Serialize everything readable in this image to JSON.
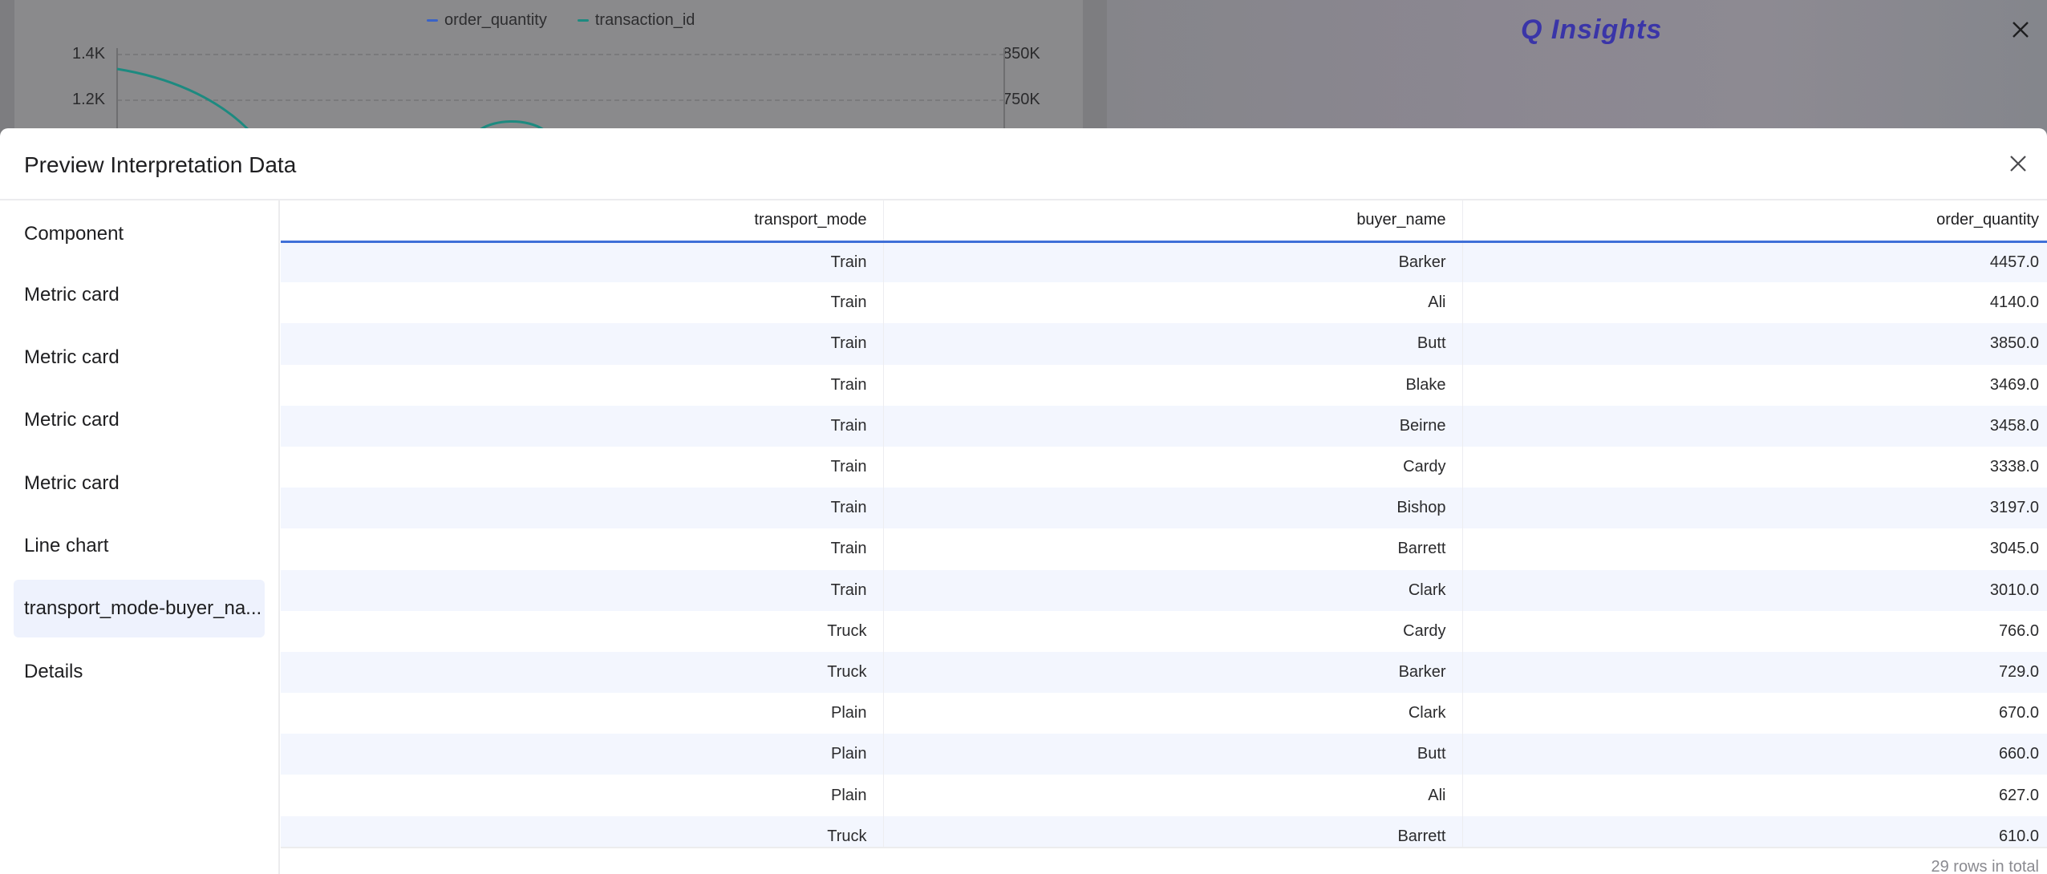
{
  "background": {
    "chart": {
      "legend": [
        {
          "label": "order_quantity",
          "color": "#3a63c7"
        },
        {
          "label": "transaction_id",
          "color": "#1d8a80"
        }
      ],
      "left_ticks": [
        "1.4K",
        "1.2K"
      ],
      "right_ticks": [
        "850K",
        "750K"
      ]
    },
    "app_title": "Q Insights"
  },
  "modal": {
    "title": "Preview Interpretation Data",
    "sidebar": {
      "heading": "Component",
      "items": [
        {
          "label": "Metric card",
          "active": false
        },
        {
          "label": "Metric card",
          "active": false
        },
        {
          "label": "Metric card",
          "active": false
        },
        {
          "label": "Metric card",
          "active": false
        },
        {
          "label": "Line chart",
          "active": false
        },
        {
          "label": "transport_mode-buyer_na...",
          "active": true
        },
        {
          "label": "Details",
          "active": false
        }
      ]
    },
    "table": {
      "columns": [
        "transport_mode",
        "buyer_name",
        "order_quantity"
      ],
      "rows": [
        [
          "Train",
          "Barker",
          "4457.0"
        ],
        [
          "Train",
          "Ali",
          "4140.0"
        ],
        [
          "Train",
          "Butt",
          "3850.0"
        ],
        [
          "Train",
          "Blake",
          "3469.0"
        ],
        [
          "Train",
          "Beirne",
          "3458.0"
        ],
        [
          "Train",
          "Cardy",
          "3338.0"
        ],
        [
          "Train",
          "Bishop",
          "3197.0"
        ],
        [
          "Train",
          "Barrett",
          "3045.0"
        ],
        [
          "Train",
          "Clark",
          "3010.0"
        ],
        [
          "Truck",
          "Cardy",
          "766.0"
        ],
        [
          "Truck",
          "Barker",
          "729.0"
        ],
        [
          "Plain",
          "Clark",
          "670.0"
        ],
        [
          "Plain",
          "Butt",
          "660.0"
        ],
        [
          "Plain",
          "Ali",
          "627.0"
        ],
        [
          "Truck",
          "Barrett",
          "610.0"
        ]
      ],
      "footer": "29 rows in total"
    }
  }
}
